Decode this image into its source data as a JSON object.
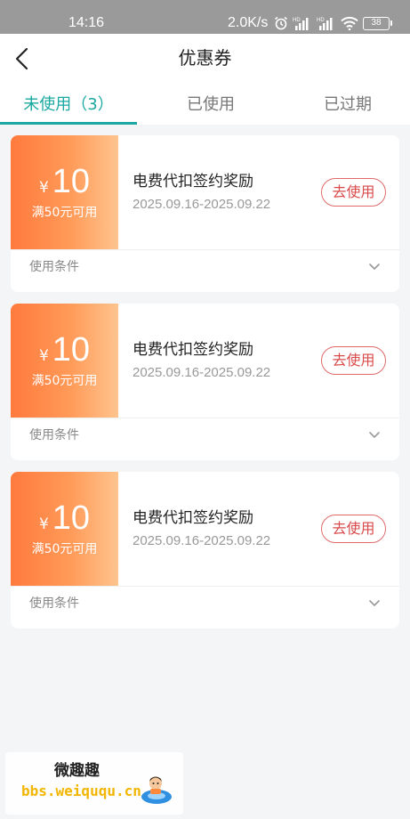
{
  "status_bar": {
    "time": "14:16",
    "network_speed": "2.0K/s",
    "battery": "38",
    "icons": [
      "alarm-icon",
      "hd-signal-icon",
      "hd-signal-icon",
      "wifi-icon",
      "battery-icon"
    ]
  },
  "header": {
    "title": "优惠券",
    "back_icon": "chevron-left-icon"
  },
  "tabs": [
    {
      "label": "未使用（3）",
      "active": true
    },
    {
      "label": "已使用",
      "active": false
    },
    {
      "label": "已过期",
      "active": false
    }
  ],
  "coupons": [
    {
      "currency": "¥",
      "amount": "10",
      "threshold": "满50元可用",
      "name": "电费代扣签约奖励",
      "validity": "2025.09.16-2025.09.22",
      "action": "去使用",
      "conditions_label": "使用条件"
    },
    {
      "currency": "¥",
      "amount": "10",
      "threshold": "满50元可用",
      "name": "电费代扣签约奖励",
      "validity": "2025.09.16-2025.09.22",
      "action": "去使用",
      "conditions_label": "使用条件"
    },
    {
      "currency": "¥",
      "amount": "10",
      "threshold": "满50元可用",
      "name": "电费代扣签约奖励",
      "validity": "2025.09.16-2025.09.22",
      "action": "去使用",
      "conditions_label": "使用条件"
    }
  ],
  "watermark": {
    "title": "微趣趣",
    "url": "bbs.weiququ.cn"
  },
  "colors": {
    "accent": "#1aa8a0",
    "coupon_gradient_start": "#ff7a3d",
    "coupon_gradient_end": "#ffc48e",
    "action": "#d94a4a"
  }
}
